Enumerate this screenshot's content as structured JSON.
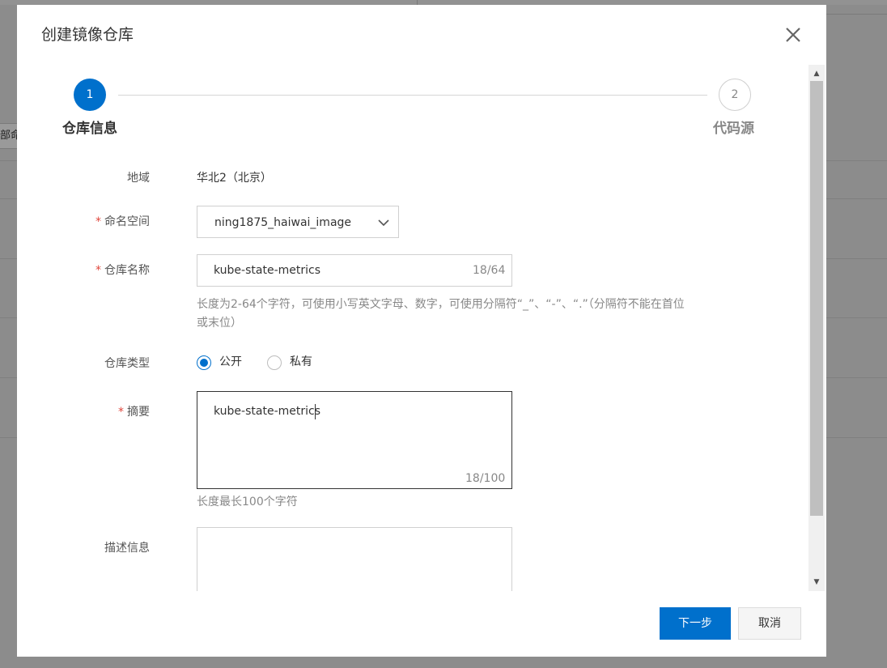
{
  "background": {
    "fragment_text": "部命"
  },
  "dialog": {
    "title": "创建镜像仓库",
    "close_icon": "close-icon"
  },
  "steps": [
    {
      "number": "1",
      "label": "仓库信息",
      "state": "active"
    },
    {
      "number": "2",
      "label": "代码源",
      "state": "inactive"
    }
  ],
  "form": {
    "region": {
      "label": "地域",
      "value": "华北2（北京）"
    },
    "namespace": {
      "required_mark": "*",
      "label": "命名空间",
      "value": "ning1875_haiwai_image"
    },
    "repo_name": {
      "required_mark": "*",
      "label": "仓库名称",
      "value": "kube-state-metrics",
      "counter": "18/64",
      "hint_line1": "长度为2-64个字符，可使用小写英文字母、数字，可使用分隔符“_”、“-”、“.”（分隔符不能在首位",
      "hint_line2": "或末位）"
    },
    "repo_type": {
      "label": "仓库类型",
      "options": [
        {
          "label": "公开",
          "checked": true
        },
        {
          "label": "私有",
          "checked": false
        }
      ]
    },
    "summary": {
      "required_mark": "*",
      "label": "摘要",
      "value": "kube-state-metrics",
      "counter": "18/100",
      "hint": "长度最长100个字符"
    },
    "description": {
      "label": "描述信息",
      "value": ""
    }
  },
  "footer": {
    "next_label": "下一步",
    "cancel_label": "取消"
  },
  "colors": {
    "primary": "#0070cc",
    "required": "#e0463c",
    "overlay": "#8c8c8c"
  }
}
